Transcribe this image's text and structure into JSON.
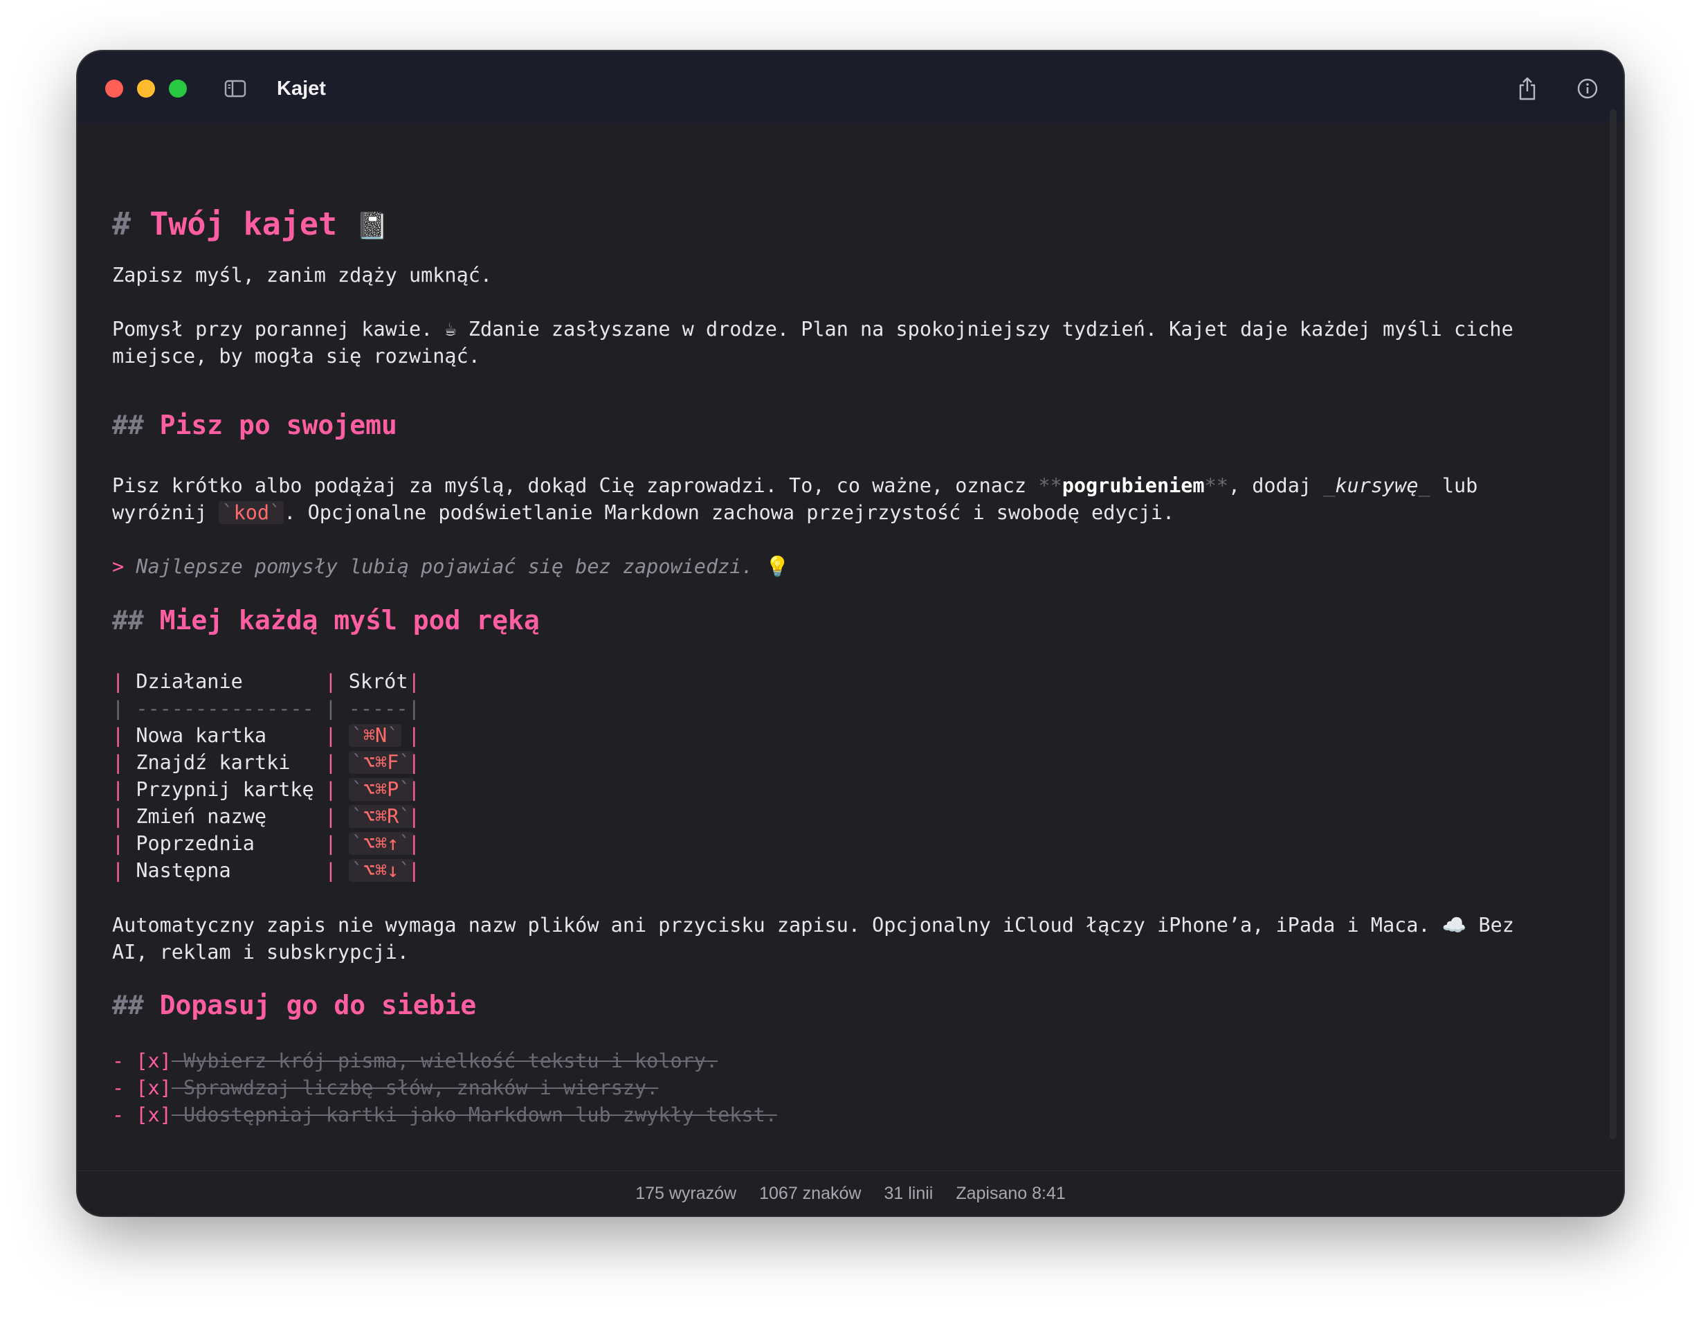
{
  "window": {
    "title": "Kajet"
  },
  "doc": {
    "h1": {
      "mark": "#",
      "text": "Twój kajet",
      "emoji": "📓"
    },
    "intro": "Zapisz myśl, zanim zdąży umknąć.",
    "p1": {
      "a": "Pomysł przy porannej kawie.",
      "emoji": "☕",
      "b": "Zdanie zasłyszane w drodze. Plan na spokojniejszy tydzień. Kajet daje każdej myśli ciche",
      "c": "miejsce, by mogła się rozwinąć."
    },
    "h2a": {
      "mark": "##",
      "text": "Pisz po swojemu"
    },
    "p2": {
      "a": "Pisz krótko albo podążaj za myślą, dokąd Cię zaprowadzi. To, co ważne, oznacz ",
      "bold_mark": "**",
      "bold": "pogrubieniem",
      "b": ", dodaj ",
      "italic_mark": "_",
      "italic": "kursywę",
      "c": " lub",
      "d": "wyróżnij ",
      "code_mark": "`",
      "code": "kod",
      "e": ". Opcjonalne podświetlanie Markdown zachowa przejrzystość i swobodę edycji."
    },
    "quote": {
      "mark": ">",
      "text": "Najlepsze pomysły lubią pojawiać się bez zapowiedzi.",
      "emoji": "💡"
    },
    "h2b": {
      "mark": "##",
      "text": "Miej każdą myśl pod ręką"
    },
    "table": {
      "pipe": "|",
      "header": [
        "Działanie",
        "Skrót"
      ],
      "separator": [
        "---------------",
        "-----"
      ],
      "rows": [
        {
          "action": "Nowa kartka",
          "shortcut": "⌘N"
        },
        {
          "action": "Znajdź kartki",
          "shortcut": "⌥⌘F"
        },
        {
          "action": "Przypnij kartkę",
          "shortcut": "⌥⌘P"
        },
        {
          "action": "Zmień nazwę",
          "shortcut": "⌥⌘R"
        },
        {
          "action": "Poprzednia",
          "shortcut": "⌥⌘↑"
        },
        {
          "action": "Następna",
          "shortcut": "⌥⌘↓"
        }
      ]
    },
    "p3": {
      "a": "Automatyczny zapis nie wymaga nazw plików ani przycisku zapisu. Opcjonalny iCloud łączy iPhone’a, iPada i Maca.",
      "emoji": "☁️",
      "b": "Bez",
      "c": "AI, reklam i subskrypcji."
    },
    "h2c": {
      "mark": "##",
      "text": "Dopasuj go do siebie"
    },
    "tasks": {
      "bullet": "-",
      "checkbox": "[x]",
      "items": [
        "Wybierz krój pisma, wielkość tekstu i kolory.",
        "Sprawdzaj liczbę słów, znaków i wierszy.",
        "Udostępniaj kartki jako Markdown lub zwykły tekst."
      ]
    }
  },
  "status": {
    "words": "175 wyrazów",
    "chars": "1067 znaków",
    "lines": "31 linii",
    "saved": "Zapisano 8:41"
  },
  "colors": {
    "heading": "#ff5fa2",
    "code": "#ff6b6b",
    "background": "#1f1f24",
    "titlebar": "#1c1d2a"
  },
  "icons": [
    "sidebar-toggle-icon",
    "share-icon",
    "info-icon"
  ]
}
